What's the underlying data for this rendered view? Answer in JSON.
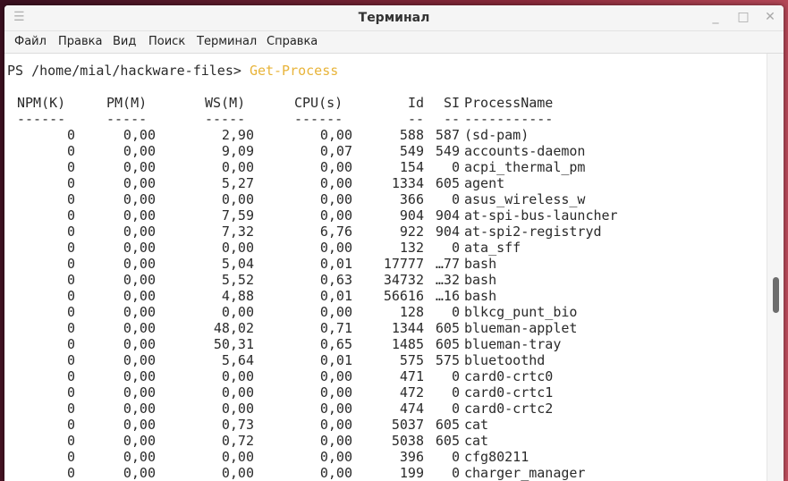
{
  "window": {
    "title": "Терминал"
  },
  "menubar": {
    "items": [
      "Файл",
      "Правка",
      "Вид",
      "Поиск",
      "Терминал",
      "Справка"
    ]
  },
  "terminal": {
    "prompt": "PS /home/mial/hackware-files> ",
    "command": "Get-Process",
    "headers": [
      "NPM(K)",
      "PM(M)",
      "WS(M)",
      "CPU(s)",
      "Id",
      "SI",
      "ProcessName"
    ],
    "separators": [
      "------",
      "-----",
      "-----",
      "------",
      "--",
      "--",
      "-----------"
    ],
    "rows": [
      [
        "0",
        "0,00",
        "2,90",
        "0,00",
        "588",
        "587",
        "(sd-pam)"
      ],
      [
        "0",
        "0,00",
        "9,09",
        "0,07",
        "549",
        "549",
        "accounts-daemon"
      ],
      [
        "0",
        "0,00",
        "0,00",
        "0,00",
        "154",
        "0",
        "acpi_thermal_pm"
      ],
      [
        "0",
        "0,00",
        "5,27",
        "0,00",
        "1334",
        "605",
        "agent"
      ],
      [
        "0",
        "0,00",
        "0,00",
        "0,00",
        "366",
        "0",
        "asus_wireless_w"
      ],
      [
        "0",
        "0,00",
        "7,59",
        "0,00",
        "904",
        "904",
        "at-spi-bus-launcher"
      ],
      [
        "0",
        "0,00",
        "7,32",
        "6,76",
        "922",
        "904",
        "at-spi2-registryd"
      ],
      [
        "0",
        "0,00",
        "0,00",
        "0,00",
        "132",
        "0",
        "ata_sff"
      ],
      [
        "0",
        "0,00",
        "5,04",
        "0,01",
        "17777",
        "…77",
        "bash"
      ],
      [
        "0",
        "0,00",
        "5,52",
        "0,63",
        "34732",
        "…32",
        "bash"
      ],
      [
        "0",
        "0,00",
        "4,88",
        "0,01",
        "56616",
        "…16",
        "bash"
      ],
      [
        "0",
        "0,00",
        "0,00",
        "0,00",
        "128",
        "0",
        "blkcg_punt_bio"
      ],
      [
        "0",
        "0,00",
        "48,02",
        "0,71",
        "1344",
        "605",
        "blueman-applet"
      ],
      [
        "0",
        "0,00",
        "50,31",
        "0,65",
        "1485",
        "605",
        "blueman-tray"
      ],
      [
        "0",
        "0,00",
        "5,64",
        "0,01",
        "575",
        "575",
        "bluetoothd"
      ],
      [
        "0",
        "0,00",
        "0,00",
        "0,00",
        "471",
        "0",
        "card0-crtc0"
      ],
      [
        "0",
        "0,00",
        "0,00",
        "0,00",
        "472",
        "0",
        "card0-crtc1"
      ],
      [
        "0",
        "0,00",
        "0,00",
        "0,00",
        "474",
        "0",
        "card0-crtc2"
      ],
      [
        "0",
        "0,00",
        "0,73",
        "0,00",
        "5037",
        "605",
        "cat"
      ],
      [
        "0",
        "0,00",
        "0,72",
        "0,00",
        "5038",
        "605",
        "cat"
      ],
      [
        "0",
        "0,00",
        "0,00",
        "0,00",
        "396",
        "0",
        "cfg80211"
      ],
      [
        "0",
        "0,00",
        "0,00",
        "0,00",
        "199",
        "0",
        "charger_manager"
      ]
    ]
  }
}
